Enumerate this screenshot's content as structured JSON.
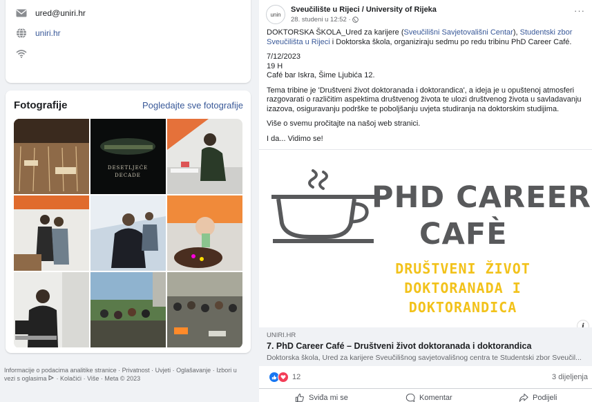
{
  "contact": {
    "email": "ured@uniri.hr",
    "website": "uniri.hr"
  },
  "photos": {
    "title": "Fotografije",
    "see_all": "Pogledajte sve fotografije",
    "event_poster_text": [
      "DESETLJEĆE",
      "DECADE"
    ]
  },
  "footer": {
    "items": [
      "Informacije o podacima analitike stranice",
      "Privatnost",
      "Uvjeti",
      "Oglašavanje",
      "Izbori u vezi s oglasima",
      "Kolačići",
      "Više",
      "Meta © 2023"
    ]
  },
  "post": {
    "avatar_text": "unin",
    "author": "Sveučilište u Rijeci / University of Rijeka",
    "time": "28. studeni u 12:52 ·",
    "intro_start": "DOKTORSKA ŠKOLA_Ured za karijere (",
    "intro_link1": "Sveučilišni Savjetovališni Centar",
    "intro_mid": "), ",
    "intro_link2": "Studentski zbor Sveučilišta u Rijeci",
    "intro_end": " i Doktorska škola, organiziraju sedmu po redu tribinu PhD Career Café.",
    "date": "7/12/2023",
    "hour": "19 H",
    "place": "Café bar Iskra, Šime Ljubića 12.",
    "topic": "Tema tribine je 'Društveni život doktoranada i doktorandica', a ideja je u opuštenoj atmosferi razgovarati o različitim aspektima društvenog života te ulozi društvenog života u savladavanju izazova, osiguravanju podrške te poboljšanju uvjeta studiranja na doktorskim studijima.",
    "more": "Više o svemu pročitajte na našoj web stranici.",
    "closing": "I da... Vidimo se!",
    "promo": {
      "line1": "PHD CAREER",
      "line2": "CAFÈ",
      "sub1": "DRUŠTVENI ŽIVOT",
      "sub2": "DOKTORANADA I",
      "sub3": "DOKTORANDICA"
    },
    "link_domain": "UNIRI.HR",
    "link_title": "7. PhD Career Café – Društveni život doktoranada i doktorandica",
    "link_desc": "Doktorska škola, Ured za karijere Sveučilišnog savjetovališnog centra te Studentski zbor Sveučil...",
    "reactions_count": "12",
    "shares": "3 dijeljenja",
    "like_label": "Sviđa mi se",
    "comment_label": "Komentar",
    "share_label": "Podijeli"
  },
  "colors": {
    "link": "#385898",
    "promo_gray": "#58595b",
    "promo_yellow": "#f2c21b",
    "like_blue": "#1877f2",
    "love_red": "#f33e58"
  }
}
